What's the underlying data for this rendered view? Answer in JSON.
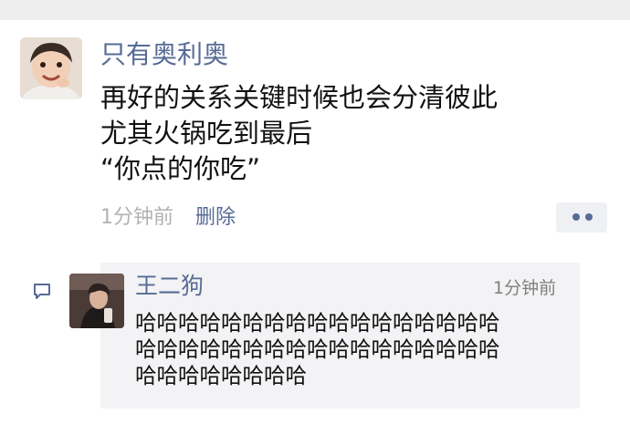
{
  "post": {
    "author": "只有奥利奥",
    "lines": [
      "再好的关系关键时候也会分清彼此",
      "尤其火锅吃到最后",
      "“你点的你吃”"
    ],
    "time": "1分钟前",
    "delete_label": "删除",
    "more_icon": "more-dots-icon"
  },
  "comment": {
    "icon": "comment-bubble-icon",
    "author": "王二狗",
    "time": "1分钟前",
    "lines": [
      "哈哈哈哈哈哈哈哈哈哈哈哈哈哈哈哈哈",
      "哈哈哈哈哈哈哈哈哈哈哈哈哈哈哈哈哈",
      "哈哈哈哈哈哈哈哈"
    ]
  },
  "colors": {
    "link_blue": "#576b95",
    "page_background": "#ffffff",
    "top_strip": "#ededed",
    "comment_background": "#f3f3f5",
    "time_gray": "#b2b2b2"
  }
}
